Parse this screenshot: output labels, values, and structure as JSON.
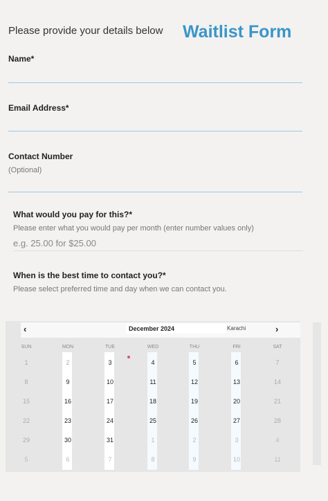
{
  "header": {
    "intro": "Please provide your details below",
    "title": "Waitlist Form"
  },
  "fields": {
    "name": {
      "label": "Name*"
    },
    "email": {
      "label": "Email Address*"
    },
    "contact": {
      "label": "Contact Number",
      "hint": "(Optional)"
    },
    "price": {
      "label": "What would you pay for this?*",
      "hint": "Please enter what you would pay per month (enter number values only)",
      "placeholder": "e.g. 25.00 for $25.00"
    },
    "time": {
      "label": "When is the best time to contact you?*",
      "hint": "Please select preferred time and day when we can contact you."
    }
  },
  "calendar": {
    "prev": "‹",
    "next": "›",
    "month": "December 2024",
    "timezone": "Karachi",
    "weekdays": [
      "SUN",
      "MON",
      "TUE",
      "WED",
      "THU",
      "FRI",
      "SAT"
    ],
    "weeks": [
      [
        "1",
        "2",
        "3",
        "4",
        "5",
        "6",
        "7"
      ],
      [
        "8",
        "9",
        "10",
        "11",
        "12",
        "13",
        "14"
      ],
      [
        "15",
        "16",
        "17",
        "18",
        "19",
        "20",
        "21"
      ],
      [
        "22",
        "23",
        "24",
        "25",
        "26",
        "27",
        "28"
      ],
      [
        "29",
        "30",
        "31",
        "1",
        "2",
        "3",
        "4"
      ],
      [
        "5",
        "6",
        "7",
        "8",
        "9",
        "10",
        "11"
      ]
    ]
  }
}
